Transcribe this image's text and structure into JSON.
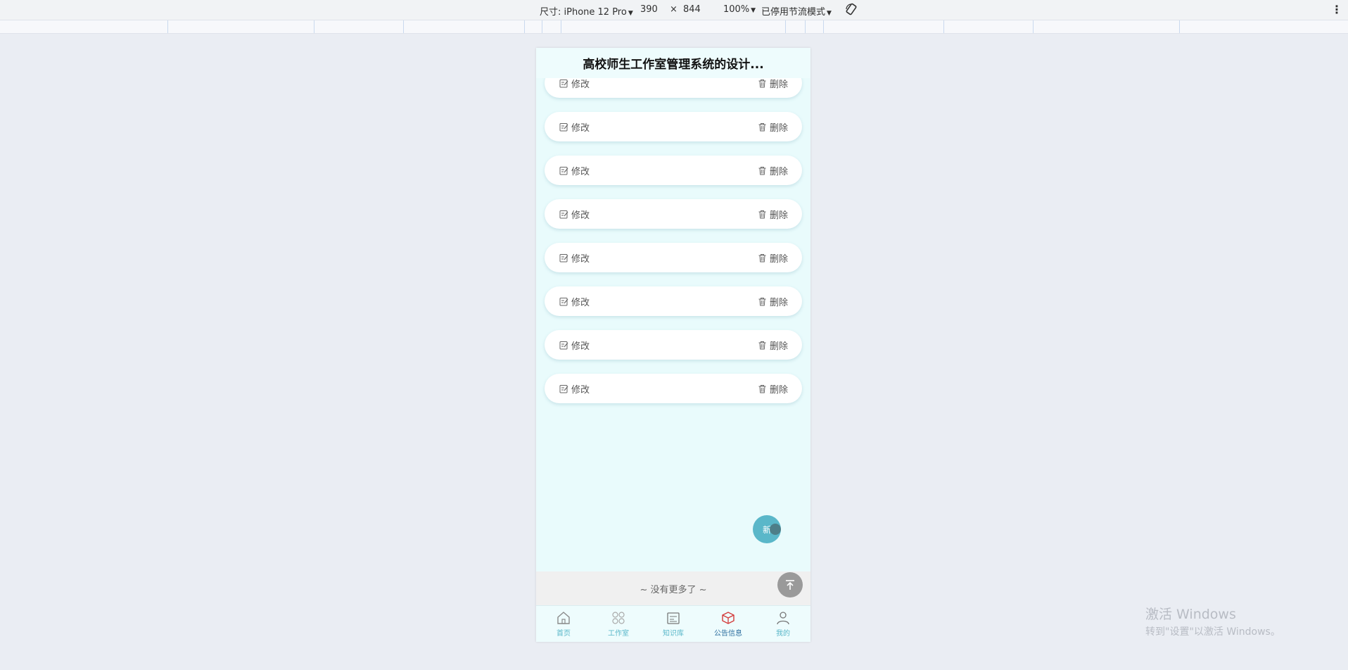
{
  "devtools": {
    "size_label": "尺寸: iPhone 12 Pro",
    "width": "390",
    "times": "×",
    "height": "844",
    "zoom": "100%",
    "throttle": "已停用节流模式",
    "more_icon": "⋮"
  },
  "app": {
    "title": "高校师生工作室管理系统的设计...",
    "cards": [
      {
        "edit": "修改",
        "delete": "删除"
      },
      {
        "edit": "修改",
        "delete": "删除"
      },
      {
        "edit": "修改",
        "delete": "删除"
      },
      {
        "edit": "修改",
        "delete": "删除"
      },
      {
        "edit": "修改",
        "delete": "删除"
      },
      {
        "edit": "修改",
        "delete": "删除"
      },
      {
        "edit": "修改",
        "delete": "删除"
      },
      {
        "edit": "修改",
        "delete": "删除"
      }
    ],
    "fab_add_label": "新",
    "no_more": "~ 没有更多了 ~",
    "tabs": [
      {
        "label": "首页",
        "icon": "home-icon"
      },
      {
        "label": "工作室",
        "icon": "grid-icon"
      },
      {
        "label": "知识库",
        "icon": "knowledge-icon"
      },
      {
        "label": "公告信息",
        "icon": "announcement-icon",
        "active": true
      },
      {
        "label": "我的",
        "icon": "user-icon"
      }
    ],
    "colors": {
      "accent": "#5ab7c9",
      "active_tab": "#d33a3a",
      "background": "#e9fbfc"
    }
  },
  "watermark": {
    "line1": "激活 Windows",
    "line2": "转到\"设置\"以激活 Windows。"
  }
}
